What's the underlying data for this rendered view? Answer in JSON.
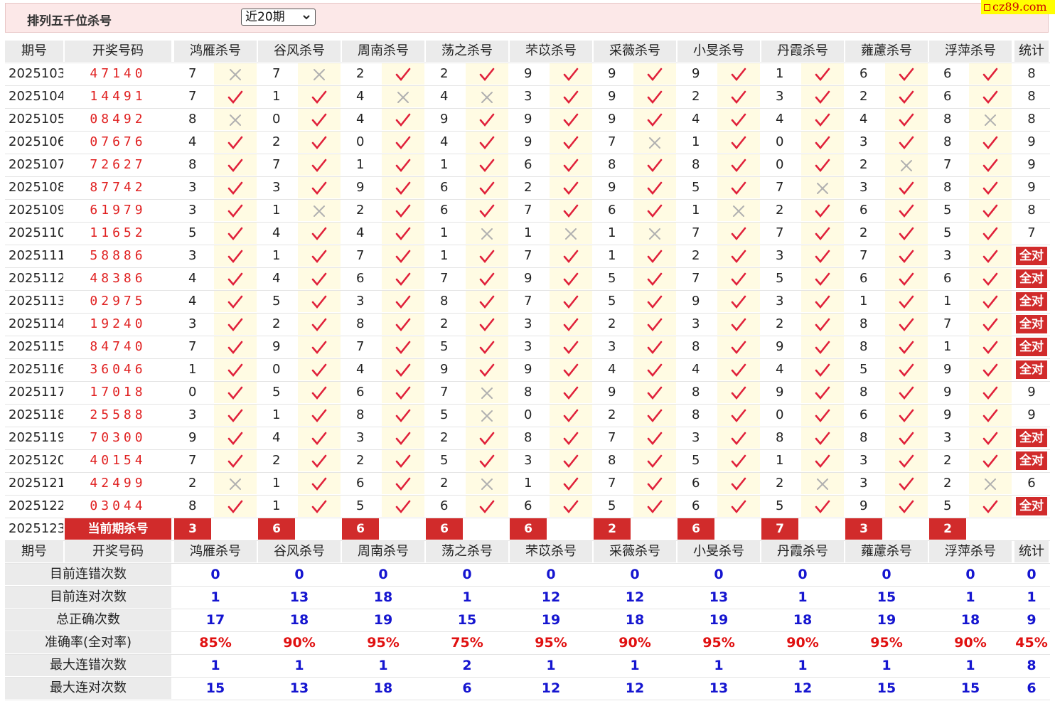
{
  "page": {
    "title": "排列五千位杀号",
    "range_select": "近20期",
    "logo_text": "cz89.com"
  },
  "columns": {
    "period": "期号",
    "draw": "开奖号码",
    "experts": [
      "鸿雁杀号",
      "谷风杀号",
      "周南杀号",
      "荡之杀号",
      "芣苡杀号",
      "采薇杀号",
      "小旻杀号",
      "丹霞杀号",
      "蕹藘杀号",
      "浮萍杀号"
    ],
    "stat": "统计"
  },
  "all_correct_label": "全对",
  "rows": [
    {
      "period": "2025103",
      "draw": "47140",
      "kills": [
        7,
        7,
        2,
        2,
        9,
        9,
        9,
        1,
        6,
        6
      ],
      "ok": [
        0,
        0,
        1,
        1,
        1,
        1,
        1,
        1,
        1,
        1
      ],
      "stat": "8"
    },
    {
      "period": "2025104",
      "draw": "14491",
      "kills": [
        7,
        1,
        4,
        4,
        3,
        9,
        2,
        3,
        2,
        6
      ],
      "ok": [
        1,
        1,
        0,
        0,
        1,
        1,
        1,
        1,
        1,
        1
      ],
      "stat": "8"
    },
    {
      "period": "2025105",
      "draw": "08492",
      "kills": [
        8,
        0,
        4,
        9,
        9,
        9,
        4,
        4,
        4,
        8
      ],
      "ok": [
        0,
        1,
        1,
        1,
        1,
        1,
        1,
        1,
        1,
        0
      ],
      "stat": "8"
    },
    {
      "period": "2025106",
      "draw": "07676",
      "kills": [
        4,
        2,
        0,
        4,
        9,
        7,
        1,
        0,
        3,
        8
      ],
      "ok": [
        1,
        1,
        1,
        1,
        1,
        0,
        1,
        1,
        1,
        1
      ],
      "stat": "9"
    },
    {
      "period": "2025107",
      "draw": "72627",
      "kills": [
        8,
        7,
        1,
        1,
        6,
        8,
        8,
        0,
        2,
        7
      ],
      "ok": [
        1,
        1,
        1,
        1,
        1,
        1,
        1,
        1,
        0,
        1
      ],
      "stat": "9"
    },
    {
      "period": "2025108",
      "draw": "87742",
      "kills": [
        3,
        3,
        9,
        6,
        2,
        9,
        5,
        7,
        3,
        8
      ],
      "ok": [
        1,
        1,
        1,
        1,
        1,
        1,
        1,
        0,
        1,
        1
      ],
      "stat": "9"
    },
    {
      "period": "2025109",
      "draw": "61979",
      "kills": [
        3,
        1,
        2,
        6,
        7,
        6,
        1,
        2,
        6,
        5
      ],
      "ok": [
        1,
        0,
        1,
        1,
        1,
        1,
        0,
        1,
        1,
        1
      ],
      "stat": "8"
    },
    {
      "period": "2025110",
      "draw": "11652",
      "kills": [
        5,
        4,
        4,
        1,
        1,
        1,
        7,
        7,
        2,
        5
      ],
      "ok": [
        1,
        1,
        1,
        0,
        0,
        0,
        1,
        1,
        1,
        1
      ],
      "stat": "7"
    },
    {
      "period": "2025111",
      "draw": "58886",
      "kills": [
        3,
        1,
        7,
        1,
        7,
        1,
        2,
        3,
        7,
        3
      ],
      "ok": [
        1,
        1,
        1,
        1,
        1,
        1,
        1,
        1,
        1,
        1
      ],
      "stat": "全对"
    },
    {
      "period": "2025112",
      "draw": "48386",
      "kills": [
        4,
        4,
        6,
        7,
        9,
        5,
        7,
        5,
        6,
        6
      ],
      "ok": [
        1,
        1,
        1,
        1,
        1,
        1,
        1,
        1,
        1,
        1
      ],
      "stat": "全对"
    },
    {
      "period": "2025113",
      "draw": "02975",
      "kills": [
        4,
        5,
        3,
        8,
        7,
        5,
        9,
        3,
        1,
        1
      ],
      "ok": [
        1,
        1,
        1,
        1,
        1,
        1,
        1,
        1,
        1,
        1
      ],
      "stat": "全对"
    },
    {
      "period": "2025114",
      "draw": "19240",
      "kills": [
        3,
        2,
        8,
        2,
        3,
        2,
        3,
        2,
        8,
        7
      ],
      "ok": [
        1,
        1,
        1,
        1,
        1,
        1,
        1,
        1,
        1,
        1
      ],
      "stat": "全对"
    },
    {
      "period": "2025115",
      "draw": "84740",
      "kills": [
        7,
        9,
        7,
        5,
        3,
        3,
        8,
        9,
        8,
        1
      ],
      "ok": [
        1,
        1,
        1,
        1,
        1,
        1,
        1,
        1,
        1,
        1
      ],
      "stat": "全对"
    },
    {
      "period": "2025116",
      "draw": "36046",
      "kills": [
        1,
        0,
        4,
        9,
        9,
        4,
        4,
        4,
        5,
        9
      ],
      "ok": [
        1,
        1,
        1,
        1,
        1,
        1,
        1,
        1,
        1,
        1
      ],
      "stat": "全对"
    },
    {
      "period": "2025117",
      "draw": "17018",
      "kills": [
        0,
        5,
        6,
        7,
        8,
        9,
        8,
        9,
        8,
        9
      ],
      "ok": [
        1,
        1,
        1,
        0,
        1,
        1,
        1,
        1,
        1,
        1
      ],
      "stat": "9"
    },
    {
      "period": "2025118",
      "draw": "25588",
      "kills": [
        3,
        1,
        8,
        5,
        0,
        2,
        8,
        0,
        6,
        9
      ],
      "ok": [
        1,
        1,
        1,
        0,
        1,
        1,
        1,
        1,
        1,
        1
      ],
      "stat": "9"
    },
    {
      "period": "2025119",
      "draw": "70300",
      "kills": [
        9,
        4,
        3,
        2,
        8,
        7,
        3,
        8,
        8,
        3
      ],
      "ok": [
        1,
        1,
        1,
        1,
        1,
        1,
        1,
        1,
        1,
        1
      ],
      "stat": "全对"
    },
    {
      "period": "2025120",
      "draw": "40154",
      "kills": [
        7,
        2,
        2,
        5,
        3,
        8,
        5,
        1,
        3,
        2
      ],
      "ok": [
        1,
        1,
        1,
        1,
        1,
        1,
        1,
        1,
        1,
        1
      ],
      "stat": "全对"
    },
    {
      "period": "2025121",
      "draw": "42499",
      "kills": [
        2,
        1,
        6,
        2,
        1,
        7,
        6,
        2,
        3,
        2
      ],
      "ok": [
        0,
        1,
        1,
        0,
        1,
        1,
        1,
        0,
        1,
        0
      ],
      "stat": "6"
    },
    {
      "period": "2025122",
      "draw": "03044",
      "kills": [
        8,
        1,
        5,
        6,
        6,
        5,
        6,
        5,
        9,
        5
      ],
      "ok": [
        1,
        1,
        1,
        1,
        1,
        1,
        1,
        1,
        1,
        1
      ],
      "stat": "全对"
    }
  ],
  "current": {
    "period": "2025123",
    "label": "当前期杀号",
    "kills": [
      3,
      6,
      6,
      6,
      6,
      2,
      6,
      7,
      3,
      2
    ]
  },
  "summary": [
    {
      "label": "目前连错次数",
      "values": [
        "0",
        "0",
        "0",
        "0",
        "0",
        "0",
        "0",
        "0",
        "0",
        "0"
      ],
      "stat": "0",
      "color": "blue"
    },
    {
      "label": "目前连对次数",
      "values": [
        "1",
        "13",
        "18",
        "1",
        "12",
        "12",
        "13",
        "1",
        "15",
        "1"
      ],
      "stat": "1",
      "color": "blue"
    },
    {
      "label": "总正确次数",
      "values": [
        "17",
        "18",
        "19",
        "15",
        "19",
        "18",
        "19",
        "18",
        "19",
        "18"
      ],
      "stat": "9",
      "color": "blue"
    },
    {
      "label": "准确率(全对率)",
      "values": [
        "85%",
        "90%",
        "95%",
        "75%",
        "95%",
        "90%",
        "95%",
        "90%",
        "95%",
        "90%"
      ],
      "stat": "45%",
      "color": "red"
    },
    {
      "label": "最大连错次数",
      "values": [
        "1",
        "1",
        "1",
        "2",
        "1",
        "1",
        "1",
        "1",
        "1",
        "1"
      ],
      "stat": "8",
      "color": "blue"
    },
    {
      "label": "最大连对次数",
      "values": [
        "15",
        "13",
        "18",
        "6",
        "12",
        "12",
        "13",
        "12",
        "15",
        "15"
      ],
      "stat": "6",
      "color": "blue"
    }
  ],
  "colors": {
    "check": "#e0203a",
    "cross": "#b0b0b0",
    "header_bg": "#ebebeb",
    "mark_bg": "#fffbe3",
    "accent": "#d12b2b",
    "blue": "#1515d0",
    "red": "#e01010"
  }
}
